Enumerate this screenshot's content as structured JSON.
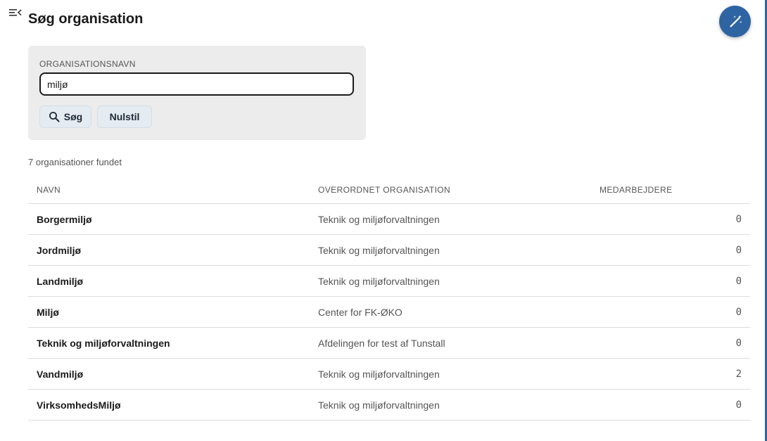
{
  "page": {
    "title": "Søg organisation"
  },
  "icons": {
    "menu": "menu-collapse-icon",
    "fab": "magic-wand-icon",
    "search": "search-icon"
  },
  "colors": {
    "accent": "#2f64a3",
    "panel": "#ececec",
    "button": "#e4ebf1"
  },
  "search": {
    "label": "ORGANISATIONSNAVN",
    "value": "miljø",
    "search_button": "Søg",
    "reset_button": "Nulstil"
  },
  "results": {
    "summary": "7 organisationer fundet",
    "columns": [
      "NAVN",
      "OVERORDNET ORGANISATION",
      "MEDARBEJDERE"
    ],
    "rows": [
      {
        "name": "Borgermiljø",
        "parent": "Teknik og miljøforvaltningen",
        "employees": "0"
      },
      {
        "name": "Jordmiljø",
        "parent": "Teknik og miljøforvaltningen",
        "employees": "0"
      },
      {
        "name": "Landmiljø",
        "parent": "Teknik og miljøforvaltningen",
        "employees": "0"
      },
      {
        "name": "Miljø",
        "parent": "Center for FK-ØKO",
        "employees": "0"
      },
      {
        "name": "Teknik og miljøforvaltningen",
        "parent": "Afdelingen for test af Tunstall",
        "employees": "0"
      },
      {
        "name": "Vandmiljø",
        "parent": "Teknik og miljøforvaltningen",
        "employees": "2"
      },
      {
        "name": "VirksomhedsMiljø",
        "parent": "Teknik og miljøforvaltningen",
        "employees": "0"
      }
    ]
  }
}
